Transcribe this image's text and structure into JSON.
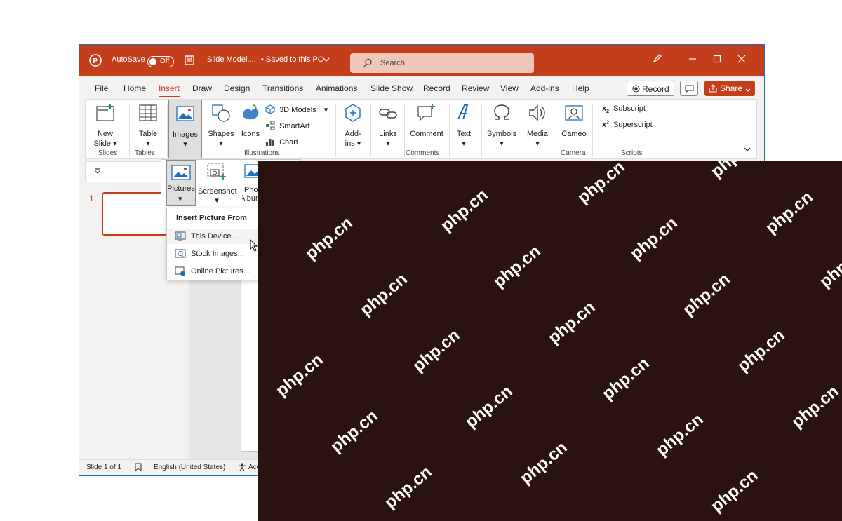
{
  "titlebar": {
    "autosave_label": "AutoSave",
    "autosave_state": "Off",
    "filename": "Slide Model....",
    "save_status": "• Saved to this PC",
    "search_placeholder": "Search"
  },
  "tabs": [
    "File",
    "Home",
    "Insert",
    "Draw",
    "Design",
    "Transitions",
    "Animations",
    "Slide Show",
    "Record",
    "Review",
    "View",
    "Add-ins",
    "Help"
  ],
  "active_tab": "Insert",
  "tab_actions": {
    "record": "Record",
    "share": "Share"
  },
  "ribbon": {
    "new_slide": [
      "New",
      "Slide"
    ],
    "slides_group": "Slides",
    "table": "Table",
    "tables_group": "Tables",
    "images": "Images",
    "shapes": "Shapes",
    "icons": "Icons",
    "models_3d": "3D Models",
    "smartart": "SmartArt",
    "chart": "Chart",
    "illustrations_group": "Illustrations",
    "addins": [
      "Add-",
      "ins"
    ],
    "links": "Links",
    "comment": "Comment",
    "comments_group": "Comments",
    "text": "Text",
    "symbols": "Symbols",
    "media": "Media",
    "cameo": "Cameo",
    "camera_group": "Camera",
    "subscript": "Subscript",
    "superscript": "Superscript",
    "scripts_group": "Scripts"
  },
  "images_dropdown": {
    "pictures": "Pictures",
    "screenshot": "Screenshot",
    "photo_album": [
      "Phot",
      "Albun"
    ]
  },
  "insert_picture_menu": {
    "header": "Insert Picture From",
    "items": [
      "This Device...",
      "Stock Images...",
      "Online Pictures..."
    ]
  },
  "slides_pane": {
    "slide_number": "1"
  },
  "status_bar": {
    "slide_count": "Slide 1 of 1",
    "language": "English (United States)",
    "accessibility": "Acc"
  },
  "watermark_text": "php.cn",
  "colors": {
    "accent": "#c43e1c",
    "watermark_bg": "#2a130e"
  }
}
